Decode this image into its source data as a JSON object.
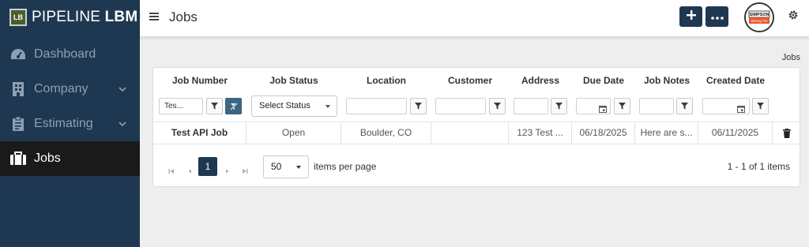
{
  "brand": {
    "box": "LB",
    "name_light": "PIPELINE",
    "name_bold": "LBM"
  },
  "sidebar": {
    "items": [
      {
        "label": "Dashboard",
        "icon": "dashboard-icon",
        "active": false,
        "expandable": false
      },
      {
        "label": "Company",
        "icon": "building-icon",
        "active": false,
        "expandable": true
      },
      {
        "label": "Estimating",
        "icon": "clipboard-icon",
        "active": false,
        "expandable": true
      },
      {
        "label": "Jobs",
        "icon": "briefcase-icon",
        "active": true,
        "expandable": false
      }
    ]
  },
  "header": {
    "title": "Jobs",
    "add_icon": "plus-icon",
    "more_icon": "ellipsis-icon",
    "avatar_top": "SIMPSON",
    "avatar_bottom": "Strong-Tie",
    "settings_icon": "gear-icon"
  },
  "breadcrumb": "Jobs",
  "grid": {
    "columns": [
      "Job Number",
      "Job Status",
      "Location",
      "Customer",
      "Address",
      "Due Date",
      "Job Notes",
      "Created Date"
    ],
    "filters": {
      "job_number": "Tes...",
      "job_status": "Select Status"
    },
    "rows": [
      {
        "job_number": "Test API Job",
        "job_status": "Open",
        "location": "Boulder, CO",
        "customer": "",
        "address": "123 Test ...",
        "due_date": "06/18/2025",
        "job_notes": "Here are s...",
        "created_date": "06/11/2025"
      }
    ]
  },
  "pager": {
    "current_page": "1",
    "page_size": "50",
    "page_size_label": "items per page",
    "info": "1 - 1 of 1 items"
  },
  "colors": {
    "sidebar": "#1f3852",
    "active_nav": "#1a1a1a",
    "accent": "#1f3852",
    "clear_filter": "#3d6683"
  }
}
